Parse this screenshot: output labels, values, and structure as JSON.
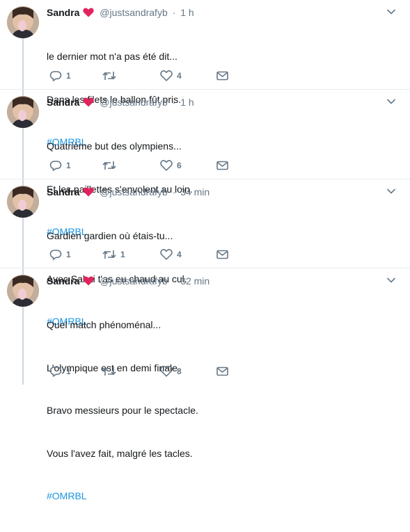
{
  "colors": {
    "link": "#1b95e0",
    "secondary": "#657786",
    "heart_red": "#e0245e",
    "divider": "#e6ecf0",
    "thread_line": "#ccd6dd"
  },
  "icons": {
    "heart_emoji": "red-heart-icon",
    "reply": "reply-icon",
    "retweet": "retweet-icon",
    "like": "like-heart-icon",
    "dm": "envelope-icon",
    "menu": "chevron-down-icon"
  },
  "tweets": [
    {
      "name": "Sandra",
      "handle": "@justsandrafyb",
      "dot": "·",
      "time": "1 h",
      "lines": [
        "le dernier mot n'a pas été dit...",
        "Dans les filets le ballon fût pris."
      ],
      "hashtag": "#OMRBL",
      "reply_count": "1",
      "retweet_count": "",
      "like_count": "4"
    },
    {
      "name": "Sandra",
      "handle": "@justsandrafyb",
      "dot": "·",
      "time": "1 h",
      "lines": [
        "Quatrième but des olympiens...",
        "Et les paillettes s'envolent au loin."
      ],
      "hashtag": "#OMRBL",
      "reply_count": "1",
      "retweet_count": "",
      "like_count": "6"
    },
    {
      "name": "Sandra",
      "handle": "@justsandrafyb",
      "dot": "·",
      "time": "34 min",
      "lines": [
        "Gardien gardien où étais-tu...",
        "Avec Sakai t'as eu chaud au cul."
      ],
      "hashtag": "#OMRBL",
      "reply_count": "1",
      "retweet_count": "1",
      "like_count": "4"
    },
    {
      "name": "Sandra",
      "handle": "@justsandrafyb",
      "dot": "·",
      "time": "32 min",
      "lines": [
        "Quel match phénoménal...",
        "L'olympique est en demi finale.",
        "Bravo messieurs pour le spectacle.",
        "Vous l'avez fait, malgré les tacles."
      ],
      "hashtag": "#OMRBL",
      "reply_count": "1",
      "retweet_count": "",
      "like_count": "8"
    }
  ]
}
